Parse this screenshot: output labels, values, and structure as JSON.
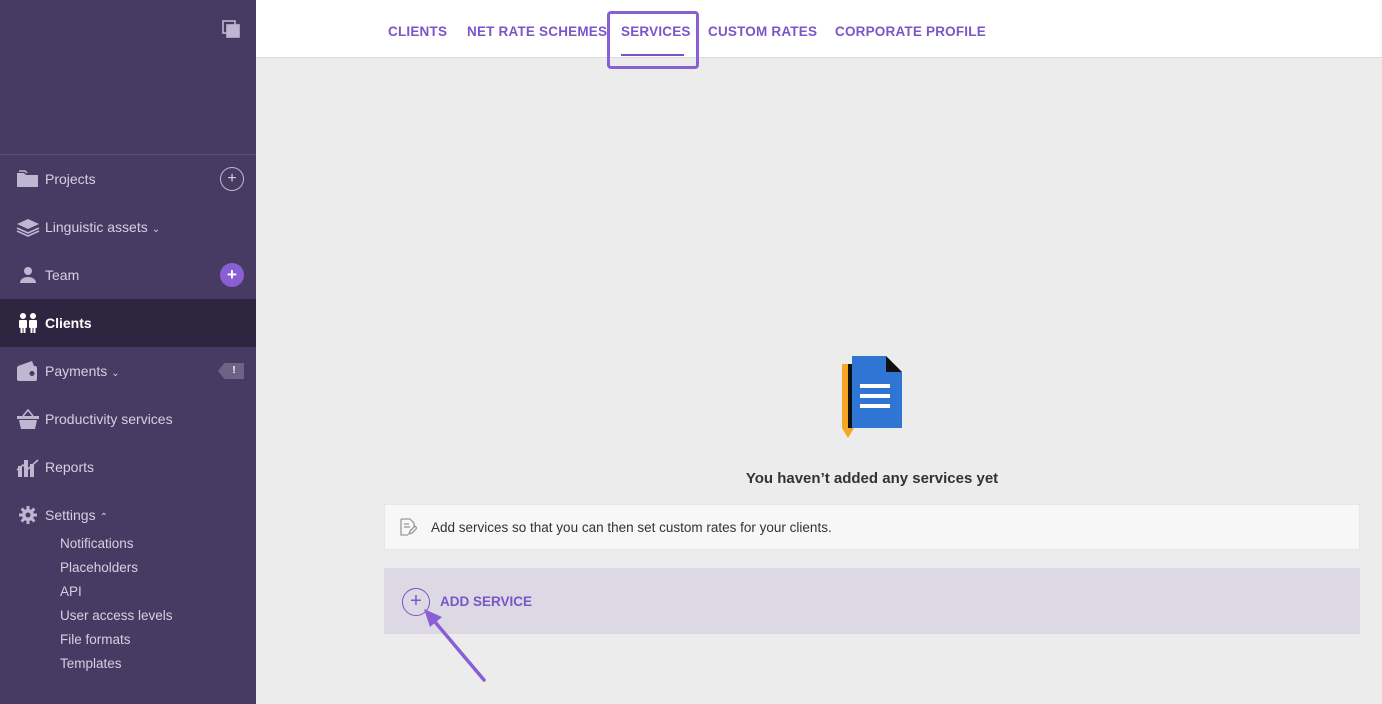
{
  "sidebar": {
    "items": [
      {
        "label": "Projects",
        "icon": "folder-icon"
      },
      {
        "label": "Linguistic assets",
        "icon": "layers-icon"
      },
      {
        "label": "Team",
        "icon": "person-icon"
      },
      {
        "label": "Clients",
        "icon": "clients-icon"
      },
      {
        "label": "Payments",
        "icon": "wallet-icon",
        "badge": "!"
      },
      {
        "label": "Productivity services",
        "icon": "basket-icon"
      },
      {
        "label": "Reports",
        "icon": "chart-icon"
      },
      {
        "label": "Settings",
        "icon": "gear-icon"
      }
    ],
    "settings_sub": [
      "Notifications",
      "Placeholders",
      "API",
      "User access levels",
      "File formats",
      "Templates"
    ]
  },
  "tabs": [
    "CLIENTS",
    "NET RATE SCHEMES",
    "SERVICES",
    "CUSTOM RATES",
    "CORPORATE PROFILE"
  ],
  "active_tab": "SERVICES",
  "empty_state": {
    "title": "You haven’t added any services yet",
    "hint": "Add services so that you can then set custom rates for your clients.",
    "add_label": "ADD SERVICE"
  },
  "colors": {
    "sidebar_bg": "#483b63",
    "accent": "#7a55c8",
    "doc_blue": "#2f76d4",
    "doc_orange": "#f5a623"
  }
}
